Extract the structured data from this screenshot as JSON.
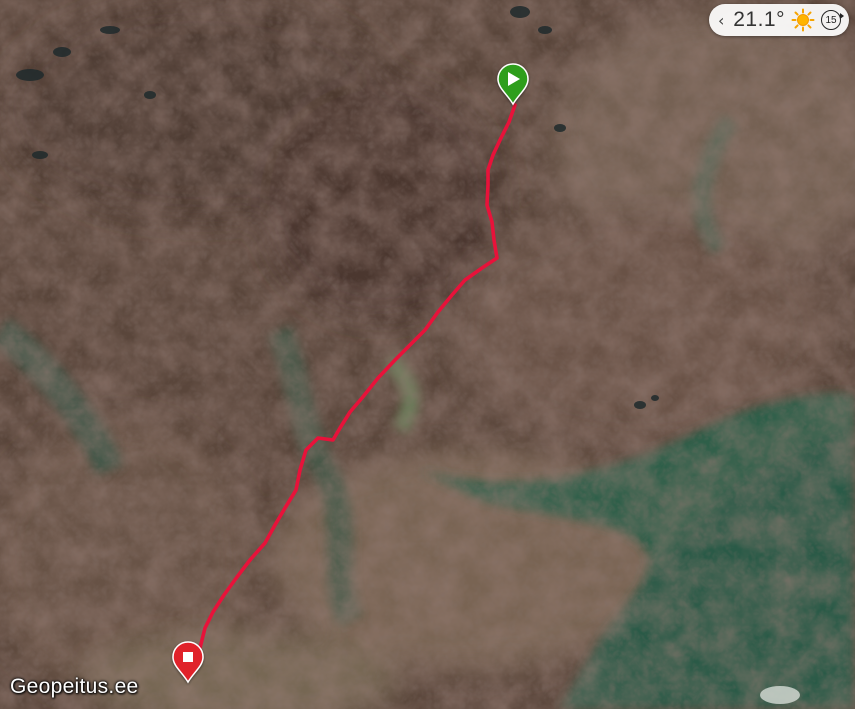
{
  "weather": {
    "temperature": "21.1°",
    "icon": "sun-icon",
    "badge": "15",
    "prev_icon": "chevron-left-icon"
  },
  "brand": {
    "label": "Geopeitus.ee"
  },
  "route": {
    "color": "#e8123a",
    "start_marker": {
      "icon": "play-icon",
      "color": "#2f9e1f"
    },
    "end_marker": {
      "icon": "stop-icon",
      "color": "#e0202c"
    }
  },
  "map": {
    "basemap": "satellite"
  }
}
